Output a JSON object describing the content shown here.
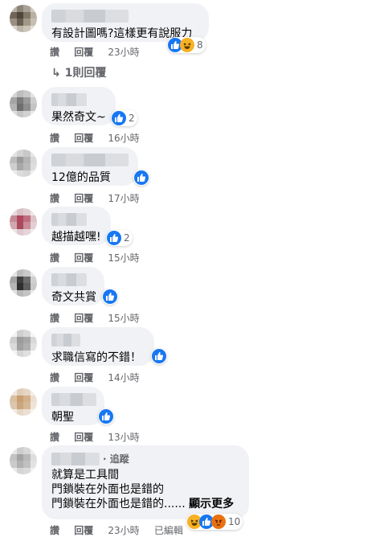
{
  "labels": {
    "like": "讚",
    "reply": "回覆",
    "edited": "已編輯",
    "follow": "追蹤",
    "see_more": "顯示更多"
  },
  "colors": {
    "like": "#1877f2",
    "haha": "#f7b125",
    "angry": "#e9710f",
    "bubble": "#f0f2f5",
    "meta": "#65676b"
  },
  "comments": [
    {
      "text": "有設計圖嗎?這樣更有說服力",
      "time": "23小時",
      "reactions": [
        "like-icon",
        "haha-icon"
      ],
      "count": "8",
      "replies_label": "1則回覆"
    },
    {
      "text": "果然奇文~",
      "time": "16小時",
      "reactions": [
        "like-icon"
      ],
      "count": "2"
    },
    {
      "text": "12億的品質",
      "time": "17小時",
      "reactions": [
        "like-icon"
      ],
      "count": ""
    },
    {
      "text": "越描越嘿!",
      "time": "15小時",
      "reactions": [
        "like-icon"
      ],
      "count": "2"
    },
    {
      "text": "奇文共賞",
      "time": "15小時",
      "reactions": [
        "like-icon"
      ],
      "count": ""
    },
    {
      "text": "求職信寫的不錯！",
      "time": "14小時",
      "reactions": [
        "like-icon"
      ],
      "count": ""
    },
    {
      "text": "朝聖",
      "time": "13小時",
      "reactions": [
        "like-icon"
      ],
      "count": ""
    },
    {
      "line1": "就算是工具間",
      "line2": "門鎖裝在外面也是錯的",
      "line3": "門鎖裝在外面也是錯的......",
      "time": "23小時",
      "reactions": [
        "haha-icon",
        "like-icon",
        "angry-icon"
      ],
      "count": "10"
    }
  ]
}
